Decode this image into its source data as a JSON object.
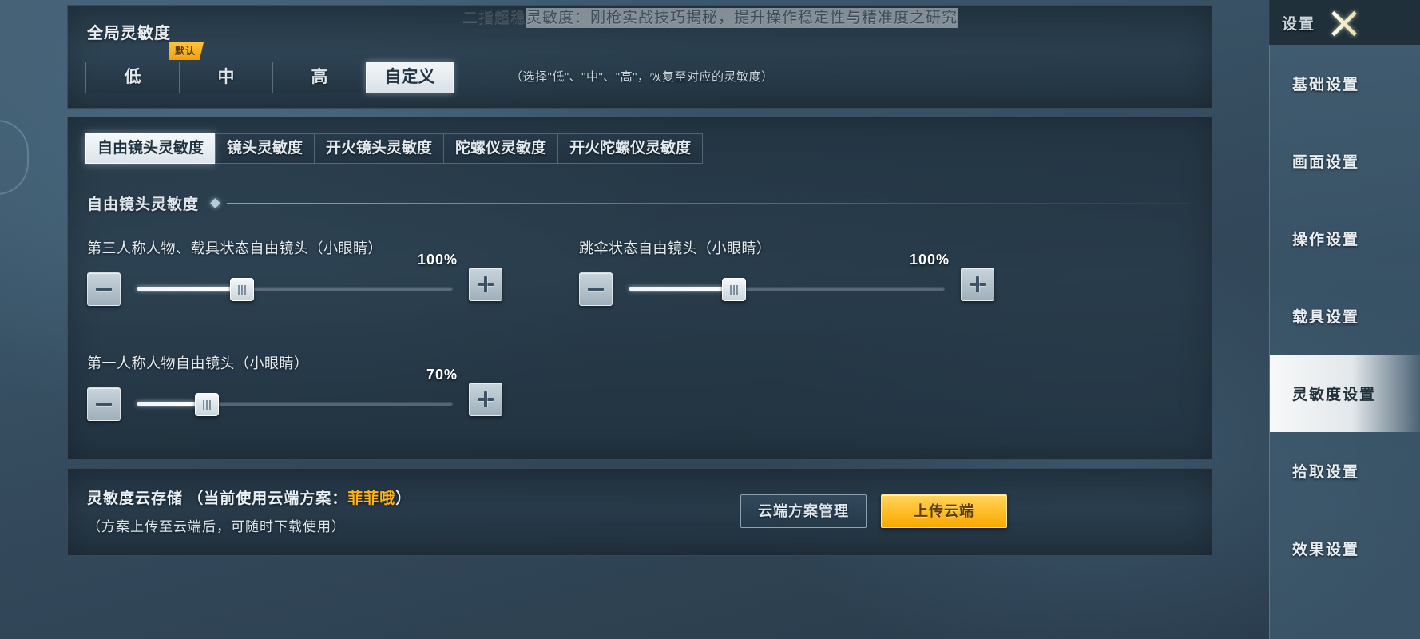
{
  "banner": {
    "text_prefix": "二指超稳",
    "text_highlight": "灵敏度：刚枪实战技巧揭秘，提升操作稳定性与精准度之研究"
  },
  "global_sensitivity": {
    "title": "全局灵敏度",
    "default_badge": "默认",
    "options": [
      "低",
      "中",
      "高",
      "自定义"
    ],
    "selected": "自定义",
    "hint": "（选择\"低\"、\"中\"、\"高\"，恢复至对应的灵敏度）"
  },
  "tabs": [
    {
      "label": "自由镜头灵敏度",
      "active": true
    },
    {
      "label": "镜头灵敏度",
      "active": false
    },
    {
      "label": "开火镜头灵敏度",
      "active": false
    },
    {
      "label": "陀螺仪灵敏度",
      "active": false
    },
    {
      "label": "开火陀螺仪灵敏度",
      "active": false
    }
  ],
  "group": {
    "title": "自由镜头灵敏度"
  },
  "sliders": [
    {
      "label": "第三人称人物、载具状态自由镜头（小眼睛）",
      "value": 100,
      "value_text": "100%",
      "minus": "−",
      "plus": "+"
    },
    {
      "label": "跳伞状态自由镜头（小眼睛）",
      "value": 100,
      "value_text": "100%",
      "minus": "−",
      "plus": "+"
    },
    {
      "label": "第一人称人物自由镜头（小眼睛）",
      "value": 70,
      "value_text": "70%",
      "minus": "−",
      "plus": "+"
    }
  ],
  "cloud": {
    "title_prefix": "灵敏度云存储 （当前使用云端方案：",
    "plan_name": "菲菲哦",
    "title_suffix": "）",
    "subtitle": "（方案上传至云端后，可随时下载使用）",
    "manage_button": "云端方案管理",
    "upload_button": "上传云端"
  },
  "sidebar": {
    "title": "设置",
    "close_icon": "close-icon",
    "items": [
      {
        "label": "基础设置",
        "active": false
      },
      {
        "label": "画面设置",
        "active": false
      },
      {
        "label": "操作设置",
        "active": false
      },
      {
        "label": "载具设置",
        "active": false
      },
      {
        "label": "灵敏度设置",
        "active": true
      },
      {
        "label": "拾取设置",
        "active": false
      },
      {
        "label": "效果设置",
        "active": false
      }
    ]
  },
  "colors": {
    "accent_orange": "#ffc02e",
    "plan_name": "#ffb21f",
    "panel_bg": "#223645",
    "active_tab_bg": "#f5f8fa"
  }
}
